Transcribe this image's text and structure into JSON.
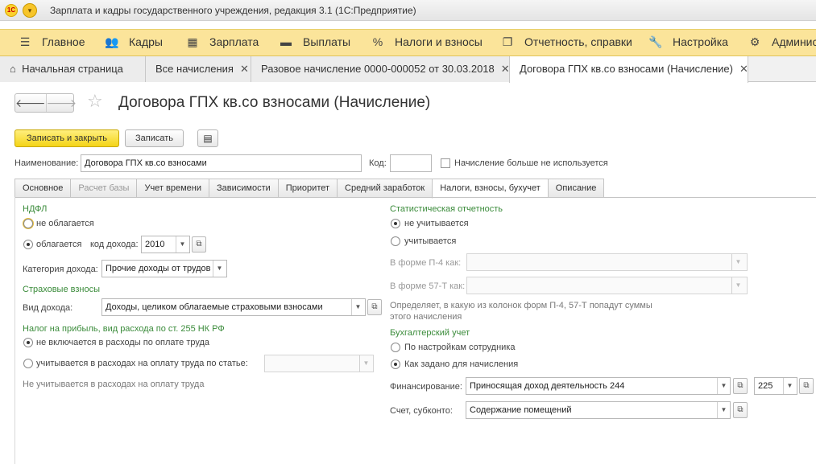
{
  "window": {
    "title": "Зарплата и кадры государственного учреждения, редакция 3.1  (1С:Предприятие)",
    "logo": "1С"
  },
  "sections": [
    {
      "label": "Главное",
      "icon": "hamburger-icon"
    },
    {
      "label": "Кадры",
      "icon": "people-icon"
    },
    {
      "label": "Зарплата",
      "icon": "calculator-icon"
    },
    {
      "label": "Выплаты",
      "icon": "wallet-icon"
    },
    {
      "label": "Налоги и взносы",
      "icon": "percent-icon"
    },
    {
      "label": "Отчетность, справки",
      "icon": "reports-icon"
    },
    {
      "label": "Настройка",
      "icon": "wrench-icon"
    },
    {
      "label": "Админист",
      "icon": "gear-icon"
    }
  ],
  "open_tabs": [
    {
      "label": "Начальная страница"
    },
    {
      "label": "Все начисления"
    },
    {
      "label": "Разовое начисление 0000-000052 от 30.03.2018"
    },
    {
      "label": "Договора ГПХ кв.со взносами (Начисление)"
    }
  ],
  "form": {
    "title": "Договора ГПХ кв.со взносами (Начисление)",
    "save_close": "Записать и закрыть",
    "save": "Записать",
    "name_label": "Наименование:",
    "name_value": "Договора ГПХ кв.со взносами",
    "code_label": "Код:",
    "code_value": "",
    "unused_label": "Начисление больше не используется",
    "tabs": [
      "Основное",
      "Расчет базы",
      "Учет времени",
      "Зависимости",
      "Приоритет",
      "Средний заработок",
      "Налоги, взносы, бухучет",
      "Описание"
    ],
    "ndfl": {
      "title": "НДФЛ",
      "not_taxed": "не облагается",
      "taxed": "облагается",
      "income_code_label": "код дохода:",
      "income_code": "2010",
      "category_label": "Категория дохода:",
      "category_value": "Прочие доходы от трудов"
    },
    "insurance": {
      "title": "Страховые взносы",
      "income_type_label": "Вид дохода:",
      "income_type_value": "Доходы, целиком облагаемые страховыми взносами"
    },
    "profit_tax": {
      "title": "Налог на прибыль, вид расхода по ст. 255 НК РФ",
      "not_included": "не включается в расходы по оплате труда",
      "included": "учитывается в расходах на оплату труда по статье:",
      "note": "Не учитывается в расходах на оплату труда"
    },
    "stat": {
      "title": "Статистическая отчетность",
      "not_counted": "не учитывается",
      "counted": "учитывается",
      "p4_label": "В форме П-4 как:",
      "t57_label": "В форме 57-Т как:",
      "note": "Определяет, в какую из колонок форм П-4, 57-Т попадут суммы этого начисления"
    },
    "accounting": {
      "title": "Бухгалтерский учет",
      "by_employee": "По настройкам сотрудника",
      "as_set": "Как задано для начисления",
      "financing_label": "Финансирование:",
      "financing_value": "Приносящая доход деятельность 244",
      "kosgu_value": "225",
      "account_label": "Счет, субконто:",
      "account_value": "Содержание помещений"
    }
  }
}
